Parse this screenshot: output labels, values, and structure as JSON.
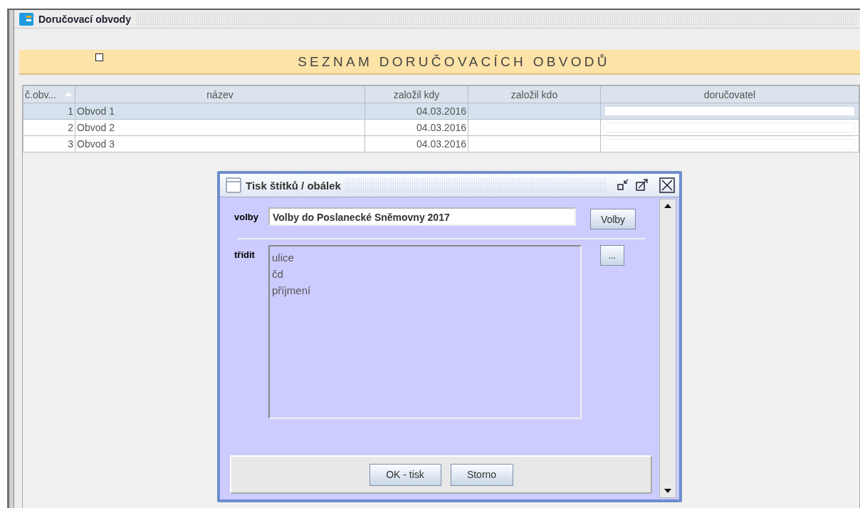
{
  "window": {
    "title": "Doručovací obvody"
  },
  "banner": {
    "title": "SEZNAM DORUČOVACÍCH OBVODŮ",
    "checkbox": {
      "checked": false
    }
  },
  "table": {
    "columns": [
      {
        "label": "č.obv...",
        "sorted": true
      },
      {
        "label": "název",
        "sorted": false
      },
      {
        "label": "založil kdy",
        "sorted": false
      },
      {
        "label": "založil kdo",
        "sorted": false
      },
      {
        "label": "doručovatel",
        "sorted": false
      }
    ],
    "rows": [
      {
        "number": "1",
        "name": "Obvod 1",
        "created": "04.03.2016",
        "selected": true
      },
      {
        "number": "2",
        "name": "Obvod 2",
        "created": "04.03.2016",
        "selected": false
      },
      {
        "number": "3",
        "name": "Obvod 3",
        "created": "04.03.2016",
        "selected": false
      }
    ]
  },
  "dialog": {
    "title": "Tisk štítků / obálek",
    "volby": {
      "label": "volby",
      "value": "Volby do Poslanecké Sněmovny 2017",
      "button": "Volby"
    },
    "sort": {
      "label": "třídit",
      "items": [
        "ulice",
        "čd",
        "příjmení"
      ],
      "button": "..."
    },
    "buttons": [
      "OK - tisk",
      "Storno"
    ]
  }
}
